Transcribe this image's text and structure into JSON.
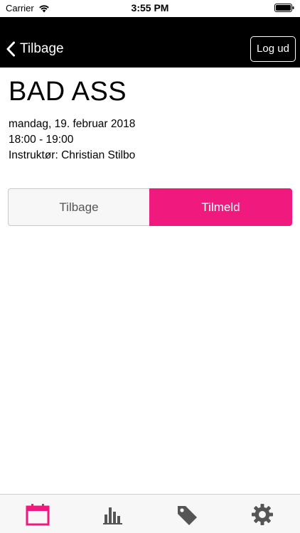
{
  "status_bar": {
    "carrier": "Carrier",
    "time": "3:55 PM"
  },
  "nav": {
    "back_label": "Tilbage",
    "logout_label": "Log ud"
  },
  "class": {
    "title": "BAD ASS",
    "date": "mandag, 19. februar 2018",
    "time": "18:00 - 19:00",
    "instructor": "Instruktør: Christian Stilbo"
  },
  "actions": {
    "back_label": "Tilbage",
    "signup_label": "Tilmeld"
  },
  "colors": {
    "accent": "#f0197d",
    "nav_bg": "#000000",
    "icon_gray": "#555555"
  },
  "tabbar": {
    "tabs": [
      {
        "icon": "calendar-icon",
        "active": true
      },
      {
        "icon": "bar-chart-icon",
        "active": false
      },
      {
        "icon": "tags-icon",
        "active": false
      },
      {
        "icon": "gear-icon",
        "active": false
      }
    ]
  }
}
